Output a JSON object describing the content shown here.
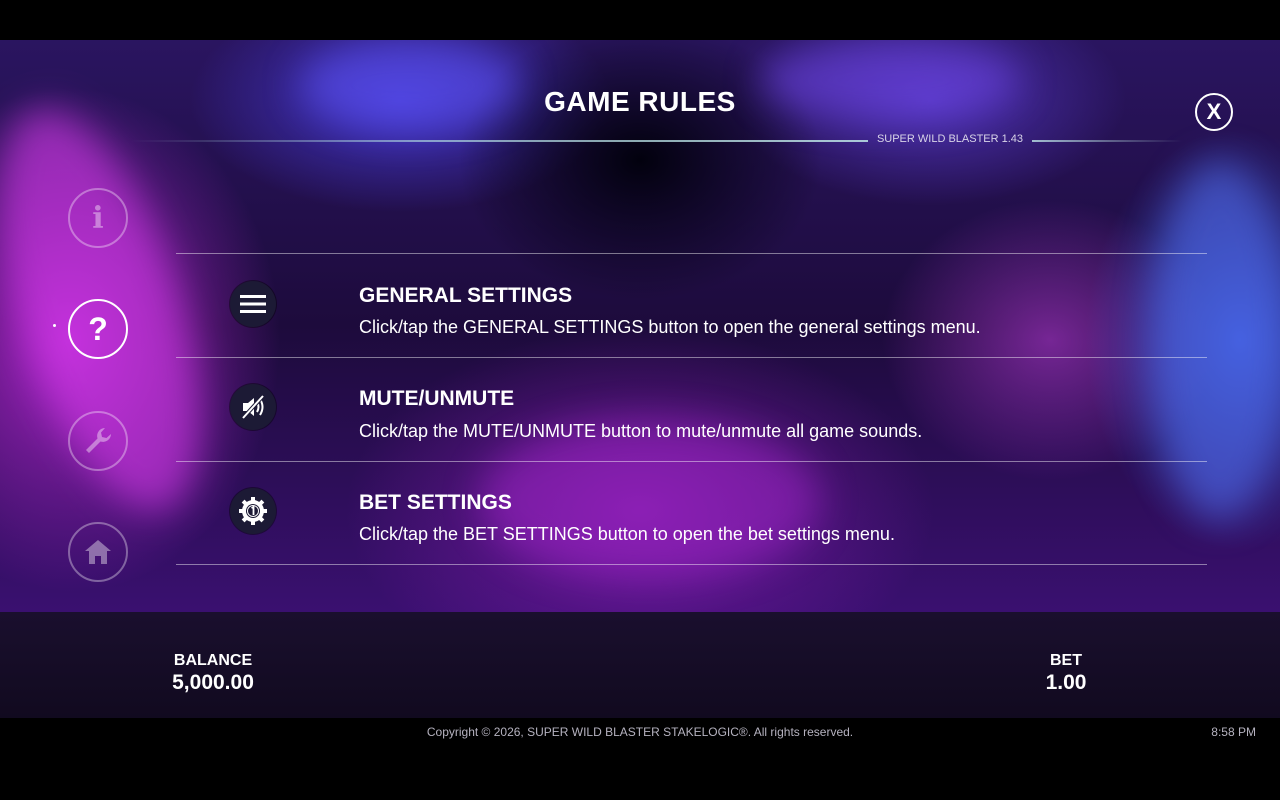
{
  "header": {
    "title": "GAME RULES",
    "version": "SUPER WILD BLASTER 1.43",
    "close_label": "X"
  },
  "nav": {
    "items": [
      {
        "name": "info",
        "icon": "info-icon",
        "glyph": "i",
        "active": false
      },
      {
        "name": "help",
        "icon": "question-icon",
        "glyph": "?",
        "active": true
      },
      {
        "name": "settings",
        "icon": "wrench-icon",
        "active": false
      },
      {
        "name": "home",
        "icon": "home-icon",
        "active": false
      }
    ]
  },
  "rules": [
    {
      "icon": "menu-icon",
      "title": "GENERAL SETTINGS",
      "description": "Click/tap the GENERAL SETTINGS button to open the general settings menu."
    },
    {
      "icon": "mute-icon",
      "title": "MUTE/UNMUTE",
      "description": "Click/tap the MUTE/UNMUTE button to mute/unmute all game sounds."
    },
    {
      "icon": "bet-settings-icon",
      "title": "BET SETTINGS",
      "description": "Click/tap the BET SETTINGS button to open the bet settings menu."
    }
  ],
  "status": {
    "balance_label": "BALANCE",
    "balance_value": "5,000.00",
    "bet_label": "BET",
    "bet_value": "1.00"
  },
  "footer": {
    "copyright": "Copyright © 2026, SUPER WILD BLASTER STAKELOGIC®. All rights reserved.",
    "time": "8:58 PM"
  },
  "colors": {
    "background_top": "#2a1560",
    "accent_purple": "#9b2fd0",
    "accent_blue": "#3b5ad8",
    "icon_bg": "#1c1a35",
    "bottom_bar": "#1a0f2e"
  }
}
